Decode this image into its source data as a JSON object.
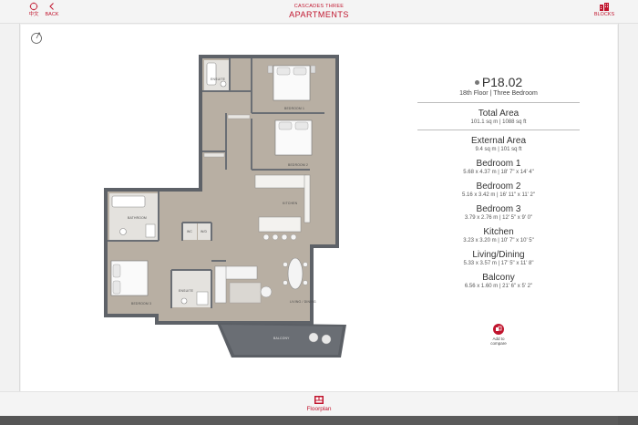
{
  "header": {
    "lang_label": "中文",
    "back_label": "BACK",
    "development": "CASCADES THREE",
    "title": "APARTMENTS",
    "blocks_label": "BLOCKS"
  },
  "colors": {
    "accent": "#c0142d",
    "floor": "#b8afa3",
    "wall": "#5e6268"
  },
  "plan_labels": {
    "ensuite_top": "ENSUITE",
    "bedroom1": "BEDROOM 1",
    "bedroom2": "BEDROOM 2",
    "kitchen": "KITCHEN",
    "bathroom": "BATHROOM",
    "wc": "WC",
    "wd": "W/D",
    "ensuite_bottom": "ENSUITE",
    "bedroom3": "BEDROOM 3",
    "living": "LIVING / DINING",
    "balcony": "BALCONY"
  },
  "unit": {
    "name": "P18.02",
    "subtitle": "18th Floor | Three Bedroom"
  },
  "metrics": [
    {
      "title": "Total Area",
      "value": "101.1 sq m | 1088 sq ft"
    },
    {
      "title": "External Area",
      "value": "9.4 sq m | 101 sq ft"
    },
    {
      "title": "Bedroom 1",
      "value": "5.68 x 4.37 m | 18' 7\" x 14' 4\""
    },
    {
      "title": "Bedroom 2",
      "value": "5.16 x 3.42 m | 16' 11\" x 11' 2\""
    },
    {
      "title": "Bedroom 3",
      "value": "3.79 x 2.76 m | 12' 5\" x 9' 0\""
    },
    {
      "title": "Kitchen",
      "value": "3.23 x 3.20 m | 10' 7\" x 10' 5\""
    },
    {
      "title": "Living/Dining",
      "value": "5.33 x 3.57 m | 17' 5\" x 11' 8\""
    },
    {
      "title": "Balcony",
      "value": "6.56 x 1.60 m | 21' 6\" x 5' 2\""
    }
  ],
  "compare": {
    "line1": "Add to",
    "line2": "compare"
  },
  "footer": {
    "tab_label": "Floorplan"
  }
}
